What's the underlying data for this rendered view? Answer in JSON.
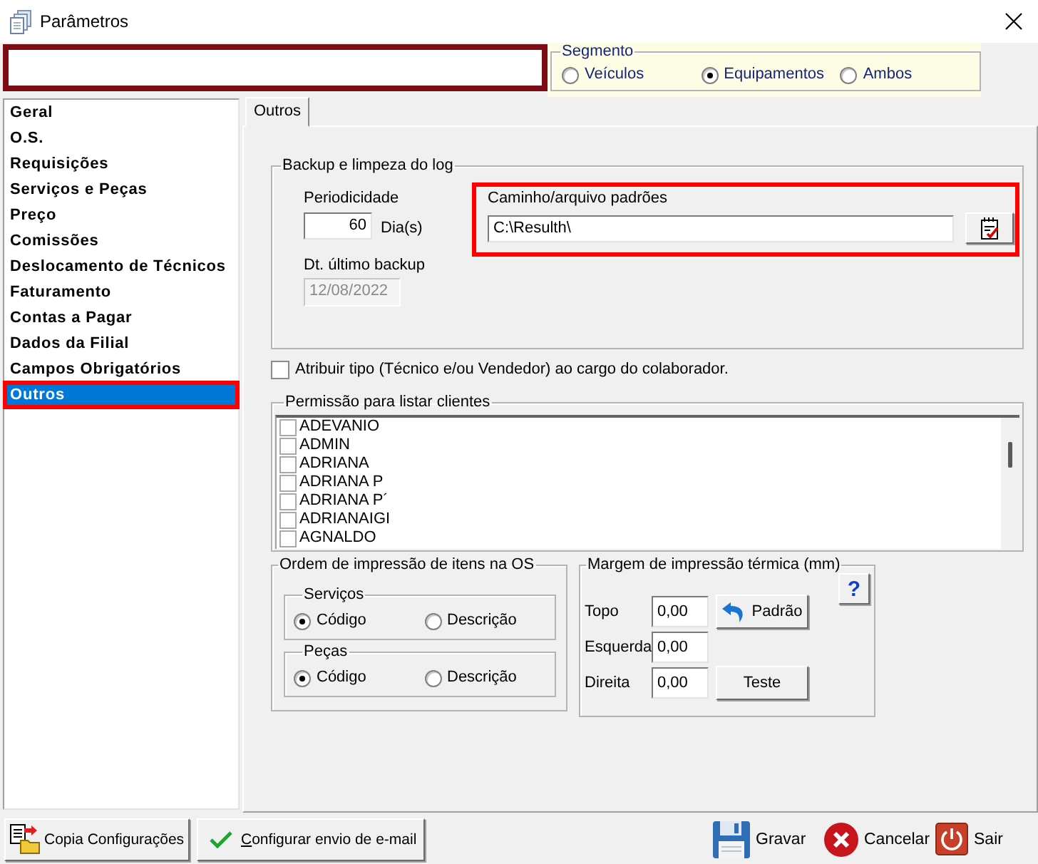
{
  "window": {
    "title": "Parâmetros"
  },
  "segment": {
    "legend": "Segmento",
    "options": [
      {
        "label": "Veículos",
        "selected": false
      },
      {
        "label": "Equipamentos",
        "selected": true
      },
      {
        "label": "Ambos",
        "selected": false
      }
    ]
  },
  "sidebar": {
    "items": [
      {
        "label": "Geral",
        "selected": false,
        "highlighted": false
      },
      {
        "label": "O.S.",
        "selected": false,
        "highlighted": false
      },
      {
        "label": "Requisições",
        "selected": false,
        "highlighted": false
      },
      {
        "label": "Serviços e Peças",
        "selected": false,
        "highlighted": false
      },
      {
        "label": "Preço",
        "selected": false,
        "highlighted": false
      },
      {
        "label": "Comissões",
        "selected": false,
        "highlighted": false
      },
      {
        "label": "Deslocamento de Técnicos",
        "selected": false,
        "highlighted": false
      },
      {
        "label": "Faturamento",
        "selected": false,
        "highlighted": false
      },
      {
        "label": "Contas a Pagar",
        "selected": false,
        "highlighted": false
      },
      {
        "label": "Dados da Filial",
        "selected": false,
        "highlighted": false
      },
      {
        "label": "Campos Obrigatórios",
        "selected": false,
        "highlighted": false
      },
      {
        "label": "Outros",
        "selected": true,
        "highlighted": true
      }
    ]
  },
  "tabs": [
    {
      "label": "Outros",
      "selected": true
    }
  ],
  "backup": {
    "legend": "Backup e limpeza do log",
    "period_label": "Periodicidade",
    "period_value": "60",
    "period_unit": "Dia(s)",
    "last_backup_label": "Dt. último backup",
    "last_backup_value": "12/08/2022",
    "last_backup_disabled": true,
    "path_label": "Caminho/arquivo padrões",
    "path_value": "C:\\Resulth\\",
    "path_highlighted": true
  },
  "assign_type": {
    "label": "Atribuir tipo (Técnico e/ou Vendedor) ao cargo do colaborador.",
    "checked": false
  },
  "client_permissions": {
    "legend": "Permissão para listar clientes",
    "items": [
      {
        "label": "ADEVANIO",
        "checked": false
      },
      {
        "label": "ADMIN",
        "checked": false
      },
      {
        "label": "ADRIANA",
        "checked": false
      },
      {
        "label": "ADRIANA P",
        "checked": false
      },
      {
        "label": "ADRIANA P´",
        "checked": false
      },
      {
        "label": "ADRIANAIGI",
        "checked": false
      },
      {
        "label": "AGNALDO",
        "checked": false
      }
    ]
  },
  "print_order": {
    "legend": "Ordem de impressão de itens na OS",
    "groups": [
      {
        "legend": "Serviços",
        "options": [
          {
            "label": "Código",
            "selected": true
          },
          {
            "label": "Descrição",
            "selected": false
          }
        ]
      },
      {
        "legend": "Peças",
        "options": [
          {
            "label": "Código",
            "selected": true
          },
          {
            "label": "Descrição",
            "selected": false
          }
        ]
      }
    ]
  },
  "thermal_margin": {
    "legend": "Margem de impressão térmica (mm)",
    "help_button": "?",
    "fields": [
      {
        "label": "Topo",
        "value": "0,00",
        "button": "Padrão"
      },
      {
        "label": "Esquerda",
        "value": "0,00"
      },
      {
        "label": "Direita",
        "value": "0,00",
        "button": "Teste"
      }
    ]
  },
  "footer": {
    "left_buttons": [
      {
        "label": "Copia Configurações",
        "shortcut_underlined": false
      },
      {
        "label": "Configurar envio de e-mail",
        "shortcut_underlined": true
      }
    ],
    "right_buttons": [
      {
        "label": "Gravar"
      },
      {
        "label": "Cancelar"
      },
      {
        "label": "Sair"
      }
    ]
  }
}
